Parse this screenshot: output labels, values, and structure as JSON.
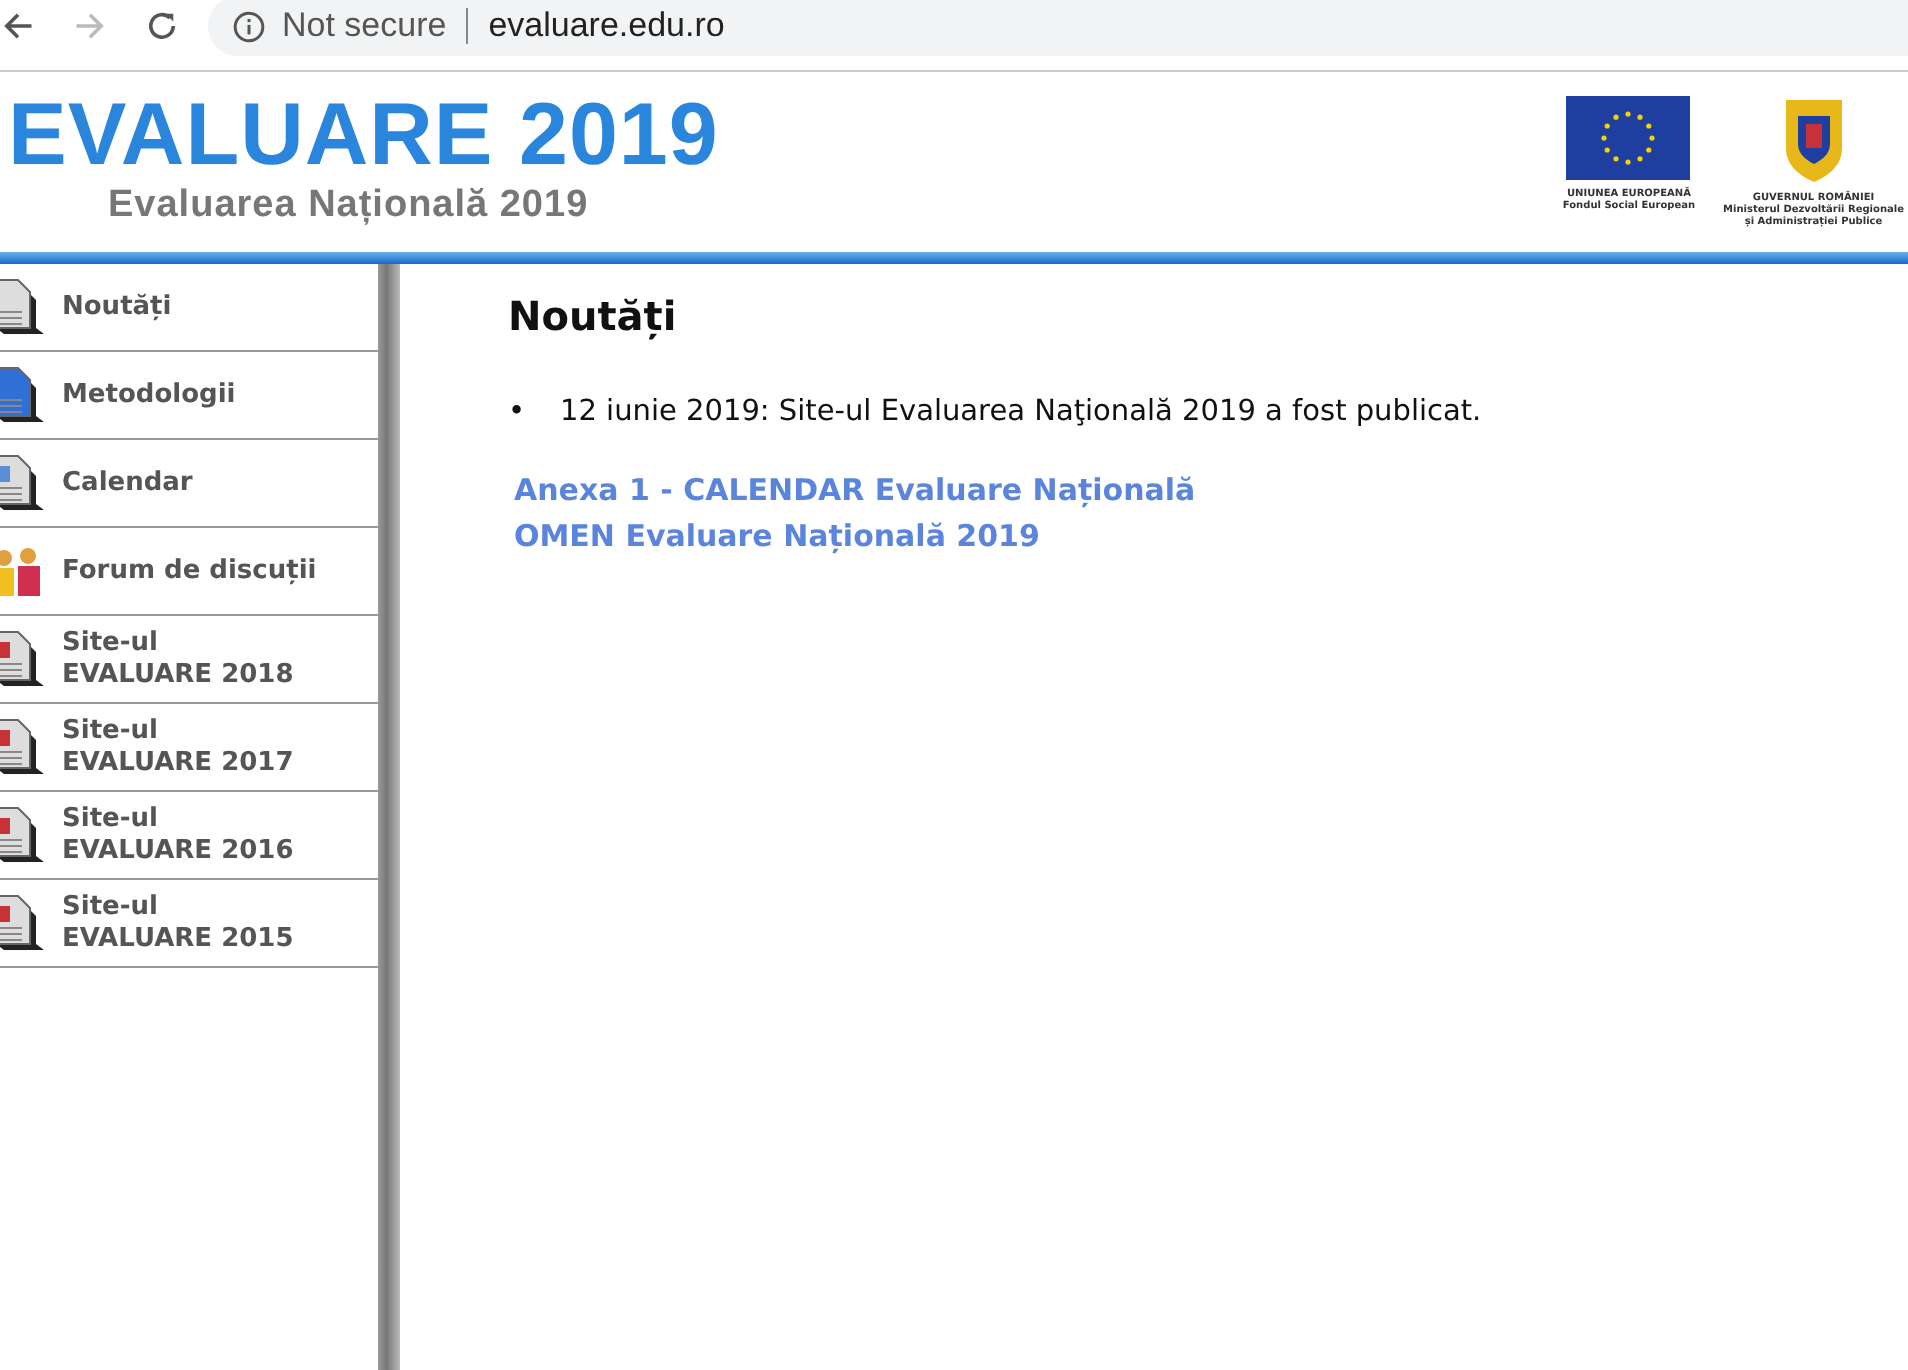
{
  "browser": {
    "security": "Not secure",
    "url": "evaluare.edu.ro"
  },
  "header": {
    "title": "EVALUARE 2019",
    "subtitle": "Evaluarea Națională 2019",
    "logos": [
      {
        "kind": "eu",
        "lines": [
          "UNIUNEA EUROPEANĂ",
          "Fondul Social European"
        ]
      },
      {
        "kind": "gov",
        "lines": [
          "GUVERNUL ROMÂNIEI",
          "Ministerul Dezvoltării Regionale",
          "și Administrației Publice"
        ]
      }
    ]
  },
  "sidebar": {
    "items": [
      {
        "kind": "document",
        "lines": [
          "Noutăți"
        ]
      },
      {
        "kind": "monitor",
        "lines": [
          "Metodologii"
        ]
      },
      {
        "kind": "calendar",
        "lines": [
          "Calendar"
        ]
      },
      {
        "kind": "people",
        "lines": [
          "Forum de discuții"
        ]
      },
      {
        "kind": "site",
        "lines": [
          "Site-ul",
          "EVALUARE 2018"
        ]
      },
      {
        "kind": "site",
        "lines": [
          "Site-ul",
          "EVALUARE 2017"
        ]
      },
      {
        "kind": "site",
        "lines": [
          "Site-ul",
          "EVALUARE 2016"
        ]
      },
      {
        "kind": "site",
        "lines": [
          "Site-ul",
          "EVALUARE 2015"
        ]
      }
    ]
  },
  "content": {
    "heading": "Noutăți",
    "news": [
      {
        "bullet": "•",
        "text": "12 iunie 2019: Site-ul Evaluarea Naţională 2019 a fost publicat."
      }
    ],
    "links": [
      "Anexa 1 - CALENDAR Evaluare Națională",
      "OMEN Evaluare Națională 2019"
    ]
  }
}
